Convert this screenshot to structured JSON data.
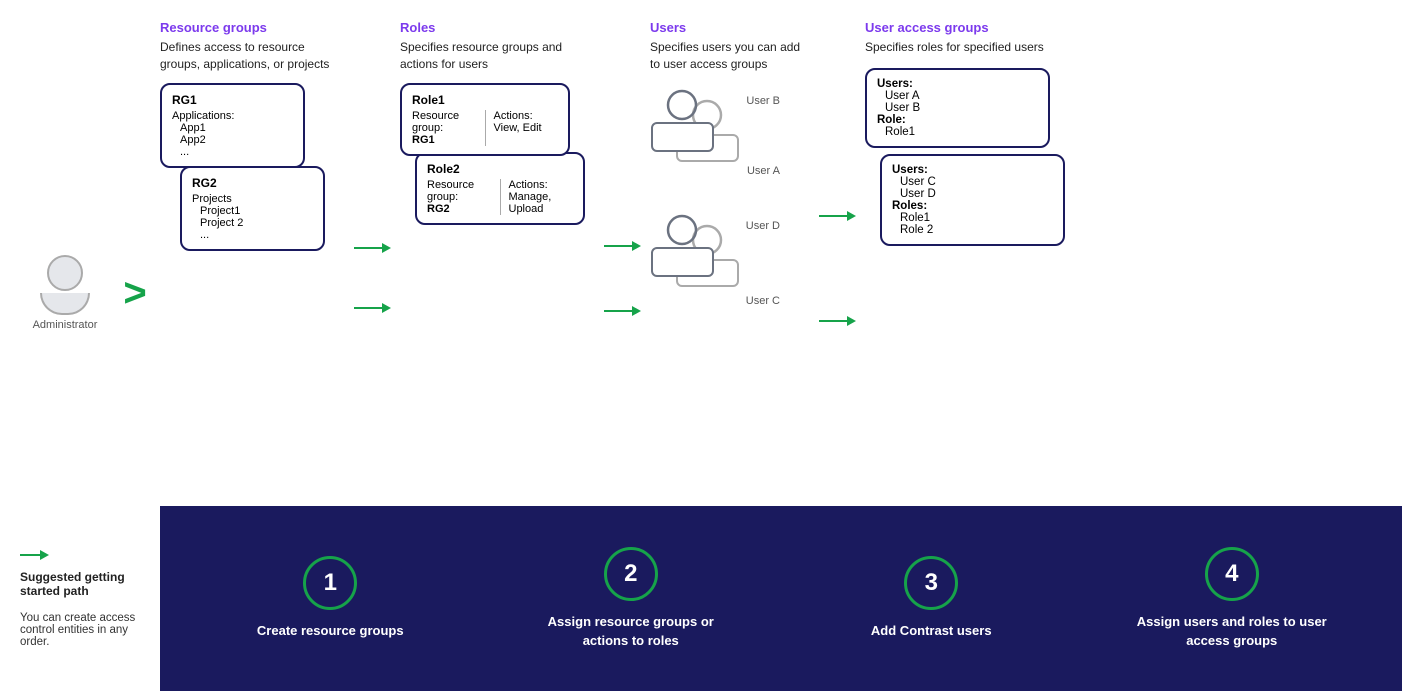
{
  "diagram": {
    "admin_label": "Administrator",
    "columns": {
      "rg": {
        "header": "Resource groups",
        "desc": "Defines access to resource groups, applications, or projects",
        "rg1": {
          "title": "RG1",
          "items": [
            "Applications:",
            "    App1",
            "    App2",
            "    ..."
          ]
        },
        "rg2": {
          "title": "RG2",
          "items": [
            "Projects",
            "    Project1",
            "    Project 2",
            "    ..."
          ]
        }
      },
      "roles": {
        "header": "Roles",
        "desc": "Specifies resource groups and actions for users",
        "role1": {
          "title": "Role1",
          "rg_label": "Resource group:",
          "rg_value": "RG1",
          "actions_label": "Actions:",
          "actions_value": "View, Edit"
        },
        "role2": {
          "title": "Role2",
          "rg_label": "Resource group:",
          "rg_value": "RG2",
          "actions_label": "Actions:",
          "actions_value": "Manage, Upload"
        }
      },
      "users": {
        "header": "Users",
        "desc": "Specifies users you can add to user access groups",
        "user_b": "User B",
        "user_a": "User A",
        "user_d": "User D",
        "user_c": "User C"
      },
      "uag": {
        "header": "User access groups",
        "desc": "Specifies roles for specified users",
        "uag1": {
          "users_label": "Users:",
          "users": [
            "User A",
            "User B"
          ],
          "role_label": "Role:",
          "role": "Role1"
        },
        "uag2": {
          "users_label": "Users:",
          "users": [
            "User C",
            "User D"
          ],
          "roles_label": "Roles:",
          "roles": [
            "Role1",
            "Role 2"
          ]
        }
      }
    }
  },
  "steps": {
    "left_text_1": "Suggested getting started path",
    "left_text_2": "You can create access control entities in any order.",
    "items": [
      {
        "number": "1",
        "label": "Create resource groups"
      },
      {
        "number": "2",
        "label": "Assign resource groups or actions to roles"
      },
      {
        "number": "3",
        "label": "Add  Contrast users"
      },
      {
        "number": "4",
        "label": "Assign users and roles to user access groups"
      }
    ]
  }
}
